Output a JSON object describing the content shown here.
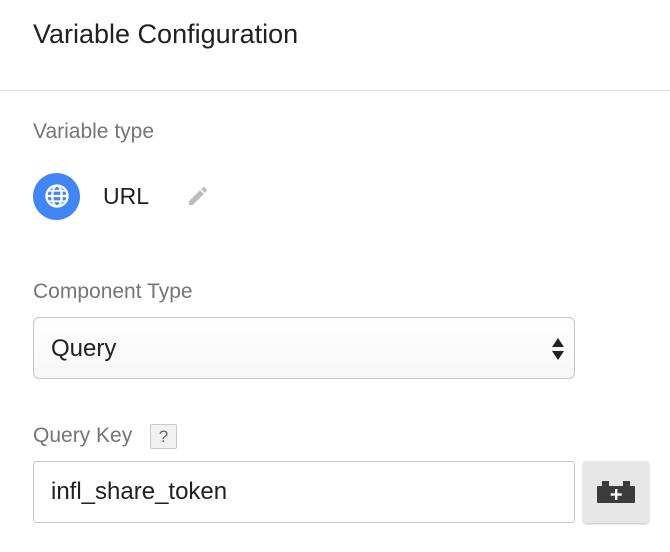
{
  "header": {
    "title": "Variable Configuration"
  },
  "variable_type": {
    "label": "Variable type",
    "icon": "globe-icon",
    "name": "URL",
    "edit_icon": "pencil-icon",
    "badge_color": "#4285f4"
  },
  "component_type": {
    "label": "Component Type",
    "selected": "Query"
  },
  "query_key": {
    "label": "Query Key",
    "help_label": "?",
    "value": "infl_share_token",
    "variable_button_icon": "add-variable-brick-icon"
  }
}
